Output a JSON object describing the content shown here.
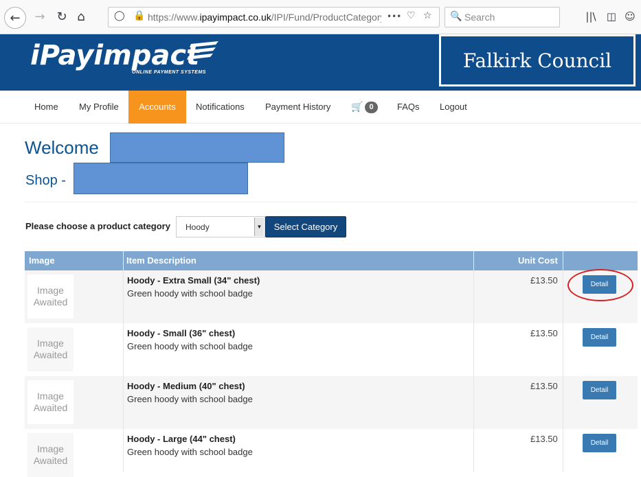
{
  "browser": {
    "url_prefix": "https://www.",
    "url_domain": "ipayimpact.co.uk",
    "url_path": "/IPI/Fund/ProductCategorySe",
    "search_placeholder": "Search",
    "more_icon": "•••"
  },
  "banner": {
    "logo": "iPayimpact",
    "logo_tagline": "ONLINE PAYMENT SYSTEMS",
    "council": "Falkirk Council"
  },
  "nav": {
    "items": [
      "Home",
      "My Profile",
      "Accounts",
      "Notifications",
      "Payment History"
    ],
    "cart_count": "0",
    "faqs": "FAQs",
    "logout": "Logout",
    "active": "Accounts",
    "active_color": "#f7941d"
  },
  "welcome": {
    "title": "Welcome",
    "shop": "Shop -"
  },
  "category": {
    "label": "Please choose a product category",
    "selected": "Hoody",
    "button": "Select Category"
  },
  "table": {
    "headers": [
      "Image",
      "Item Description",
      "Unit Cost"
    ],
    "rows": [
      {
        "image": "Image Awaited",
        "title": "Hoody - Extra Small (34\" chest)",
        "desc": "Green hoody with school badge",
        "price": "£13.50",
        "action": "Detail"
      },
      {
        "image": "Image Awaited",
        "title": "Hoody - Small (36\" chest)",
        "desc": "Green hoody with school badge",
        "price": "£13.50",
        "action": "Detail"
      },
      {
        "image": "Image Awaited",
        "title": "Hoody - Medium (40\" chest)",
        "desc": "Green hoody with school badge",
        "price": "£13.50",
        "action": "Detail"
      },
      {
        "image": "Image Awaited",
        "title": "Hoody - Large (44\" chest)",
        "desc": "Green hoody with school badge",
        "price": "£13.50",
        "action": "Detail"
      }
    ]
  },
  "colors": {
    "brand_blue": "#0f4c8c",
    "header_blue": "#7fa7cf",
    "button_blue": "#3a7ab3",
    "annotation_red": "#d42020"
  }
}
